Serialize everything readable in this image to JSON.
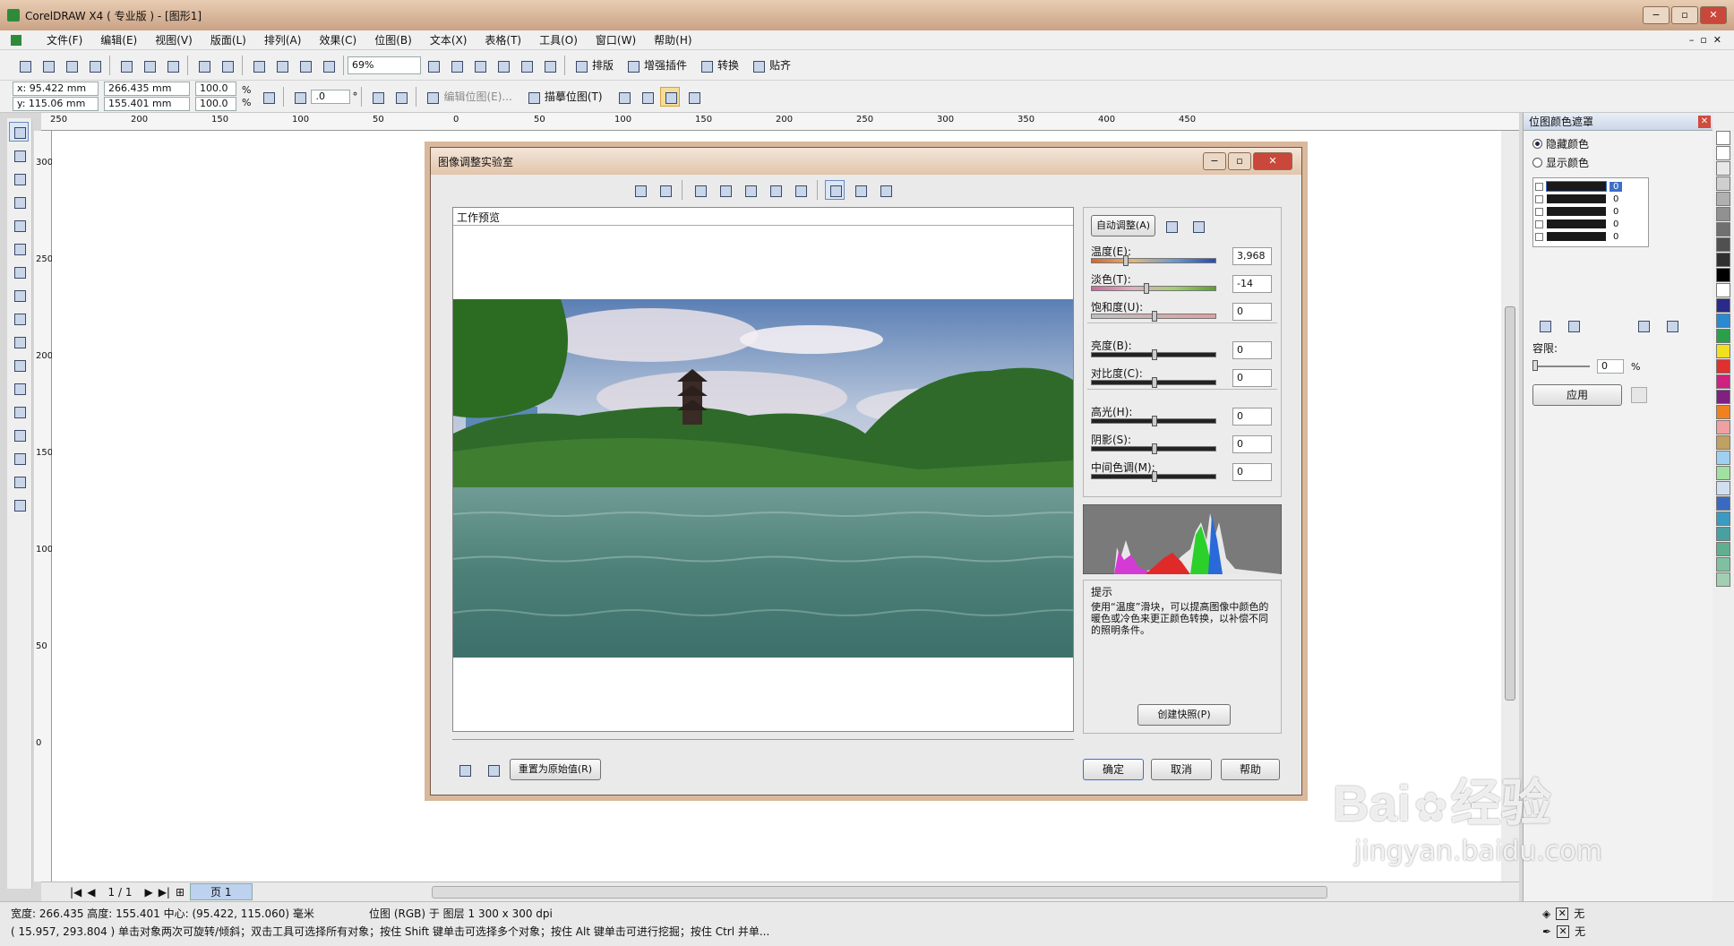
{
  "window": {
    "title": "CorelDRAW X4 ( 专业版 ) - [图形1]"
  },
  "menu": [
    "文件(F)",
    "编辑(E)",
    "视图(V)",
    "版面(L)",
    "排列(A)",
    "效果(C)",
    "位图(B)",
    "文本(X)",
    "表格(T)",
    "工具(O)",
    "窗口(W)",
    "帮助(H)"
  ],
  "toolbar1": {
    "zoom": "69%",
    "labels": [
      "排版",
      "增强插件",
      "转换",
      "贴齐"
    ]
  },
  "property_bar": {
    "x": "x: 95.422 mm",
    "y": "y: 115.06 mm",
    "width": "266.435 mm",
    "height": "155.401 mm",
    "scale_x": "100.0",
    "scale_y": "100.0",
    "percent": "%",
    "rotation": ".0",
    "degree": "°",
    "edit_bitmap": "编辑位图(E)...",
    "trace_bitmap": "描摹位图(T)"
  },
  "ruler_h": [
    "250",
    "200",
    "150",
    "100",
    "50",
    "0",
    "50",
    "100",
    "150",
    "200",
    "250",
    "300",
    "350",
    "400",
    "450"
  ],
  "ruler_v": [
    "300",
    "250",
    "200",
    "150",
    "100",
    "50",
    "0"
  ],
  "dialog": {
    "title": "图像调整实验室",
    "preview_label": "工作预览",
    "auto_adjust": "自动调整(A)",
    "sliders": [
      {
        "label": "温度(E):",
        "value": "3,968",
        "pos": 0.26
      },
      {
        "label": "淡色(T):",
        "value": "-14",
        "pos": 0.43
      },
      {
        "label": "饱和度(U):",
        "value": "0",
        "pos": 0.5
      },
      {
        "label": "亮度(B):",
        "value": "0",
        "pos": 0.5
      },
      {
        "label": "对比度(C):",
        "value": "0",
        "pos": 0.5
      },
      {
        "label": "高光(H):",
        "value": "0",
        "pos": 0.5
      },
      {
        "label": "阴影(S):",
        "value": "0",
        "pos": 0.5
      },
      {
        "label": "中间色调(M):",
        "value": "0",
        "pos": 0.5
      }
    ],
    "hint_title": "提示",
    "hint_text": "使用“温度”滑块，可以提高图像中颜色的暖色或冷色来更正颜色转换，以补偿不同的照明条件。",
    "snapshot": "创建快照(P)",
    "reset": "重置为原始值(R)",
    "ok": "确定",
    "cancel": "取消",
    "help": "帮助"
  },
  "docker": {
    "title": "位图颜色遮罩",
    "hide_colors": "隐藏颜色",
    "show_colors": "显示颜色",
    "rows": [
      "0",
      "0",
      "0",
      "0",
      "0"
    ],
    "tolerance_label": "容限:",
    "tolerance_value": "0",
    "percent": "%",
    "apply": "应用"
  },
  "pagebar": {
    "page_count": "1 / 1",
    "page_tab": "页 1"
  },
  "status": {
    "line1_left": "宽度: 266.435 高度: 155.401 中心: (95.422, 115.060) 毫米",
    "line1_mid": "位图 (RGB) 于 图层 1 300 x 300 dpi",
    "line2": "( 15.957, 293.804 )     单击对象两次可旋转/倾斜；双击工具可选择所有对象；按住 Shift 键单击可选择多个对象；按住 Alt 键单击可进行挖掘；按住 Ctrl 并单...",
    "fill_none": "无",
    "outline_none": "无"
  },
  "watermark": {
    "brand": "Bai",
    "brand2": "经验",
    "url": "jingyan.baidu.com"
  },
  "colors": {
    "title_bg": "#caa285",
    "accent": "#3d6fc9"
  }
}
